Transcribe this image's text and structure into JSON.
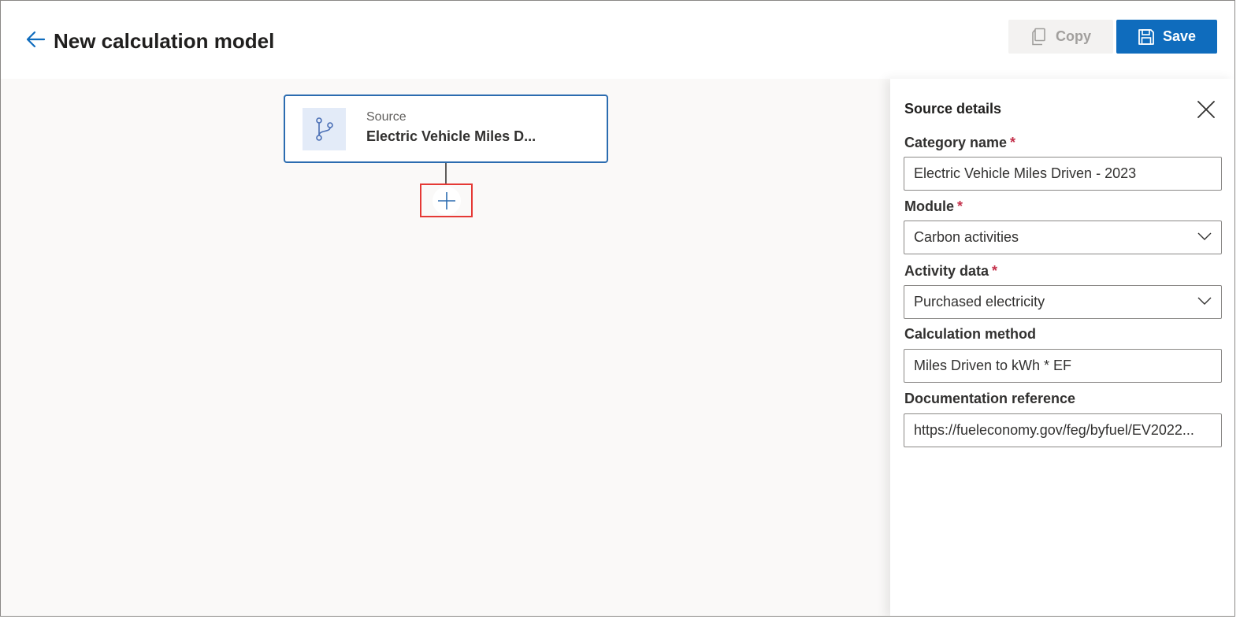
{
  "header": {
    "title": "New calculation model",
    "copy_label": "Copy",
    "save_label": "Save"
  },
  "canvas": {
    "source_card": {
      "kicker": "Source",
      "name": "Electric Vehicle Miles D..."
    }
  },
  "panel": {
    "title": "Source details",
    "fields": {
      "category_name": {
        "label": "Category name",
        "value": "Electric Vehicle Miles Driven - 2023",
        "required": "*"
      },
      "module": {
        "label": "Module",
        "value": "Carbon activities",
        "required": "*"
      },
      "activity_data": {
        "label": "Activity data",
        "value": "Purchased electricity",
        "required": "*"
      },
      "calculation_method": {
        "label": "Calculation method",
        "value": "Miles Driven to kWh * EF"
      },
      "documentation_reference": {
        "label": "Documentation reference",
        "value": "https://fueleconomy.gov/feg/byfuel/EV2022..."
      }
    }
  },
  "colors": {
    "accent": "#0f6cbd",
    "card_border": "#2b6cb0",
    "highlight_box": "#e53935",
    "required": "#c4314b",
    "canvas_bg": "#faf9f8"
  },
  "icons": {
    "back": "arrow-left-icon",
    "copy": "copy-icon",
    "save": "save-icon",
    "source": "branch-icon",
    "add": "plus-icon",
    "close": "close-icon",
    "dropdown": "chevron-down-icon"
  }
}
